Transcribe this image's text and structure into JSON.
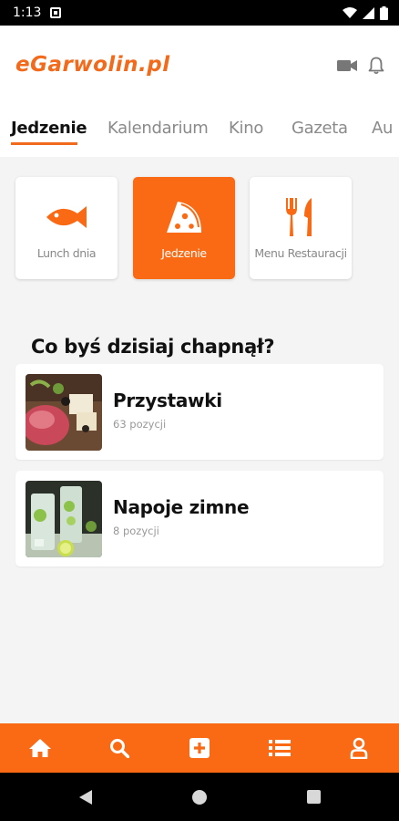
{
  "status_bar": {
    "time": "1:13"
  },
  "header": {
    "logo": "eGarwolin.pl"
  },
  "tabs": [
    {
      "label": "Jedzenie"
    },
    {
      "label": "Kalendarium"
    },
    {
      "label": "Kino"
    },
    {
      "label": "Gazeta"
    },
    {
      "label": "Au"
    }
  ],
  "categories": [
    {
      "label": "Lunch dnia",
      "icon": "fish-icon"
    },
    {
      "label": "Jedzenie",
      "icon": "pizza-icon"
    },
    {
      "label": "Menu Restauracji",
      "icon": "fork-knife-icon"
    }
  ],
  "section": {
    "title": "Co byś dzisiaj chapnął?"
  },
  "menu": [
    {
      "name": "Przystawki",
      "count": "63 pozycji"
    },
    {
      "name": "Napoje zimne",
      "count": "8 pozycji"
    }
  ],
  "colors": {
    "accent": "#fa6a14",
    "logo": "#f26a1b"
  }
}
